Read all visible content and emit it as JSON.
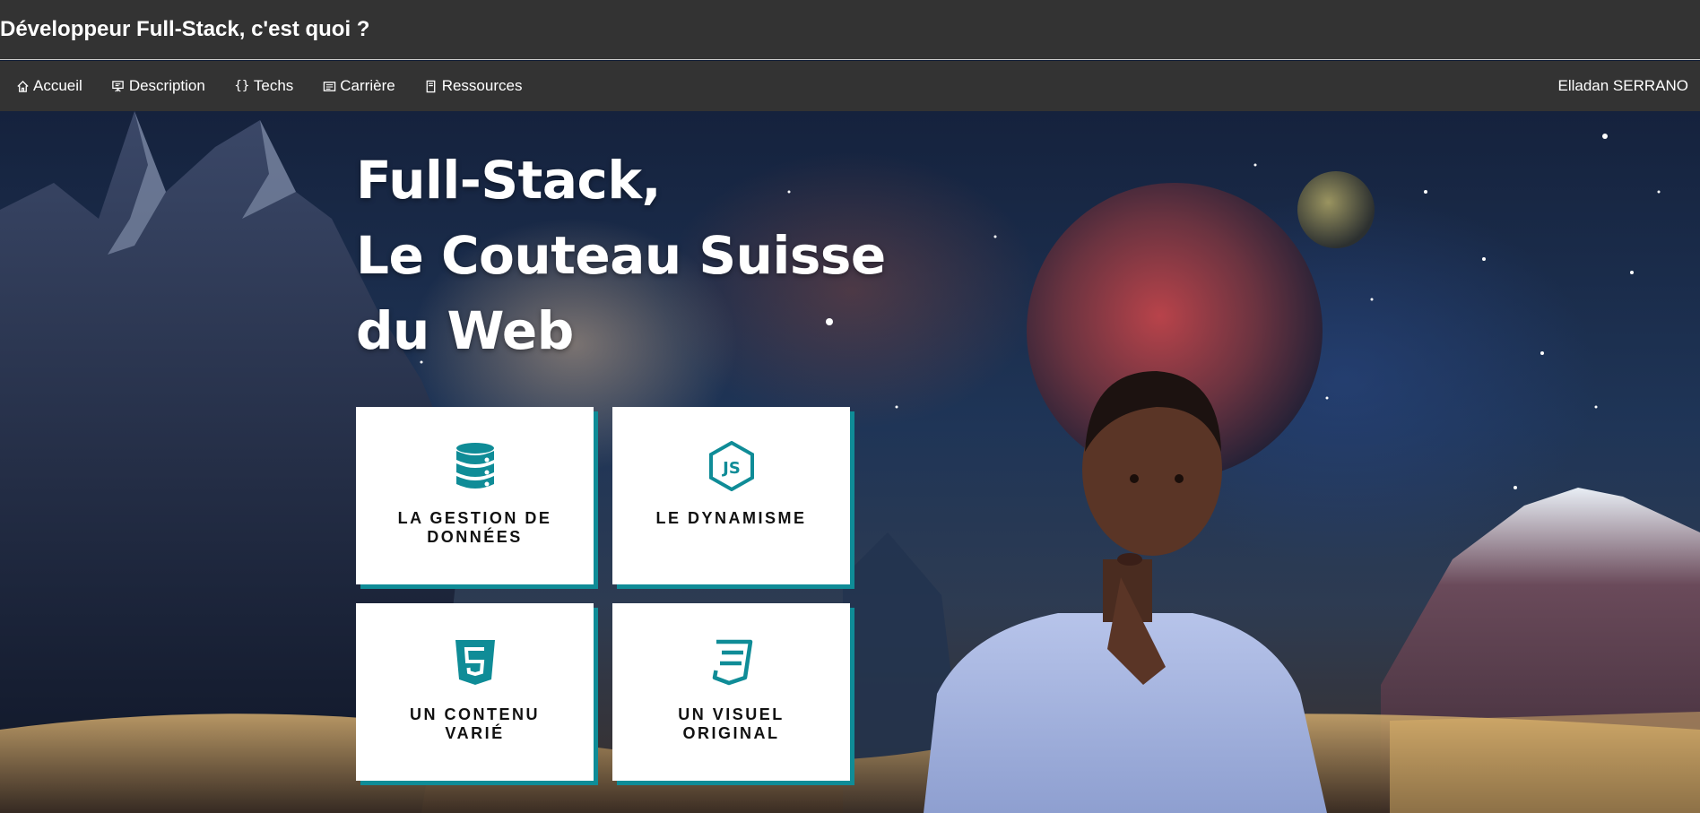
{
  "header": {
    "title": "Développeur Full-Stack, c'est quoi ?"
  },
  "nav": {
    "items": [
      {
        "label": "Accueil",
        "icon": "home-icon"
      },
      {
        "label": "Description",
        "icon": "presentation-icon"
      },
      {
        "label": "Techs",
        "icon": "braces-icon"
      },
      {
        "label": "Carrière",
        "icon": "id-card-icon"
      },
      {
        "label": "Ressources",
        "icon": "book-icon"
      }
    ],
    "author": "Elladan SERRANO"
  },
  "hero": {
    "headline": [
      "Full-Stack,",
      "Le Couteau Suisse",
      "du Web"
    ],
    "cards": [
      {
        "label": "LA GESTION DE DONNÉES",
        "icon": "database-icon"
      },
      {
        "label": "LE DYNAMISME",
        "icon": "nodejs-icon"
      },
      {
        "label": "UN CONTENU VARIÉ",
        "icon": "html5-icon"
      },
      {
        "label": "UN VISUEL ORIGINAL",
        "icon": "css3-icon"
      }
    ]
  },
  "colors": {
    "bar": "#333333",
    "accent": "#0f8c97",
    "card_bg": "#ffffff",
    "text_light": "#ffffff"
  }
}
